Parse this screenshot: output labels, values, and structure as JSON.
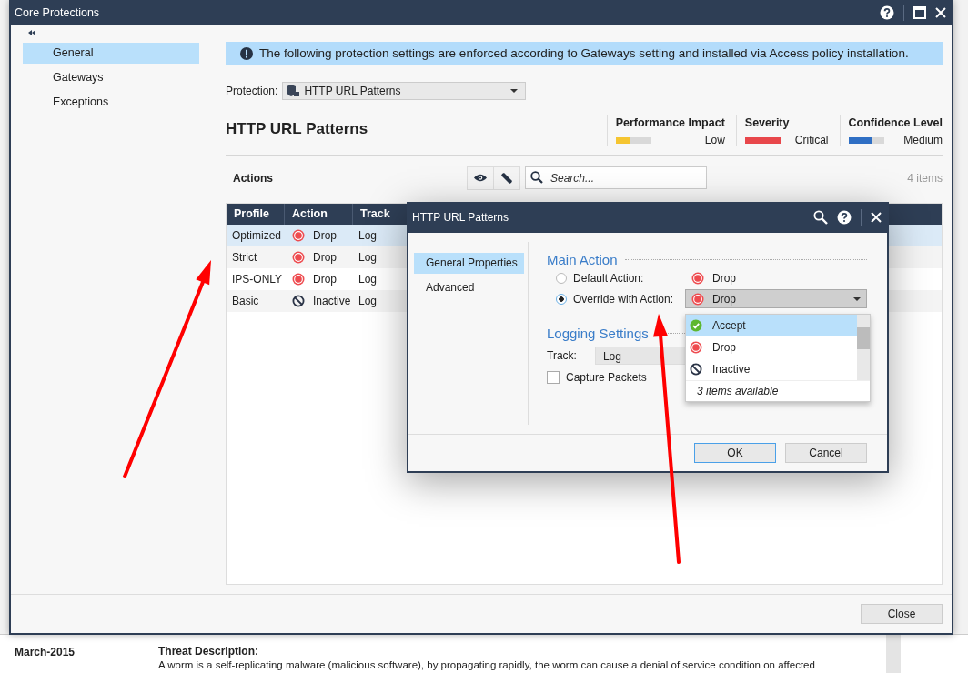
{
  "window": {
    "title": "Core Protections"
  },
  "sidebar": {
    "items": [
      {
        "label": "General",
        "selected": true
      },
      {
        "label": "Gateways",
        "selected": false
      },
      {
        "label": "Exceptions",
        "selected": false
      }
    ]
  },
  "banner": {
    "text": "The following protection settings are enforced according to Gateways setting and installed via Access policy installation."
  },
  "protection": {
    "label": "Protection:",
    "value": "HTTP URL Patterns"
  },
  "heading": "HTTP URL Patterns",
  "metrics": [
    {
      "label": "Performance Impact",
      "level": 0.4,
      "reading": "Low",
      "color": "#f5c531"
    },
    {
      "label": "Severity",
      "level": 1,
      "reading": "Critical",
      "color": "#e8474b"
    },
    {
      "label": "Confidence Level",
      "level": 0.67,
      "reading": "Medium",
      "color": "#2f6fc4"
    }
  ],
  "actions": {
    "title": "Actions",
    "search_placeholder": "Search...",
    "count": "4 items"
  },
  "table": {
    "columns": [
      "Profile",
      "Action",
      "Track"
    ],
    "rows": [
      {
        "profile": "Optimized",
        "action": {
          "kind": "drop",
          "label": "Drop"
        },
        "track": "Log",
        "selected": true
      },
      {
        "profile": "Strict",
        "action": {
          "kind": "drop",
          "label": "Drop"
        },
        "track": "Log",
        "selected": false
      },
      {
        "profile": "IPS-ONLY",
        "action": {
          "kind": "drop",
          "label": "Drop"
        },
        "track": "Log",
        "selected": false
      },
      {
        "profile": "Basic",
        "action": {
          "kind": "inactive",
          "label": "Inactive"
        },
        "track": "Log",
        "selected": false
      }
    ]
  },
  "close_button": "Close",
  "dialog": {
    "title": "HTTP URL Patterns",
    "nav": [
      {
        "label": "General Properties",
        "selected": true
      },
      {
        "label": "Advanced",
        "selected": false
      }
    ],
    "main_action": {
      "heading": "Main Action",
      "options": [
        {
          "label": "Default Action:",
          "selected": false,
          "value": {
            "kind": "drop",
            "label": "Drop"
          }
        },
        {
          "label": "Override with Action:",
          "selected": true,
          "value": {
            "kind": "drop",
            "label": "Drop"
          }
        }
      ]
    },
    "logging": {
      "heading": "Logging Settings",
      "track_label": "Track:",
      "track_value": "Log",
      "capture_label": "Capture Packets",
      "capture_checked": false
    },
    "buttons": [
      "OK",
      "Cancel"
    ]
  },
  "dropdown": {
    "items": [
      {
        "kind": "accept",
        "label": "Accept",
        "selected": true
      },
      {
        "kind": "drop",
        "label": "Drop",
        "selected": false
      },
      {
        "kind": "inactive",
        "label": "Inactive",
        "selected": false
      }
    ],
    "footer": "3 items available"
  },
  "background": {
    "date": "March-2015",
    "heading": "Threat Description:",
    "text": "A worm is a self-replicating malware (malicious software), by propagating rapidly, the worm can cause a denial of service condition on affected"
  }
}
